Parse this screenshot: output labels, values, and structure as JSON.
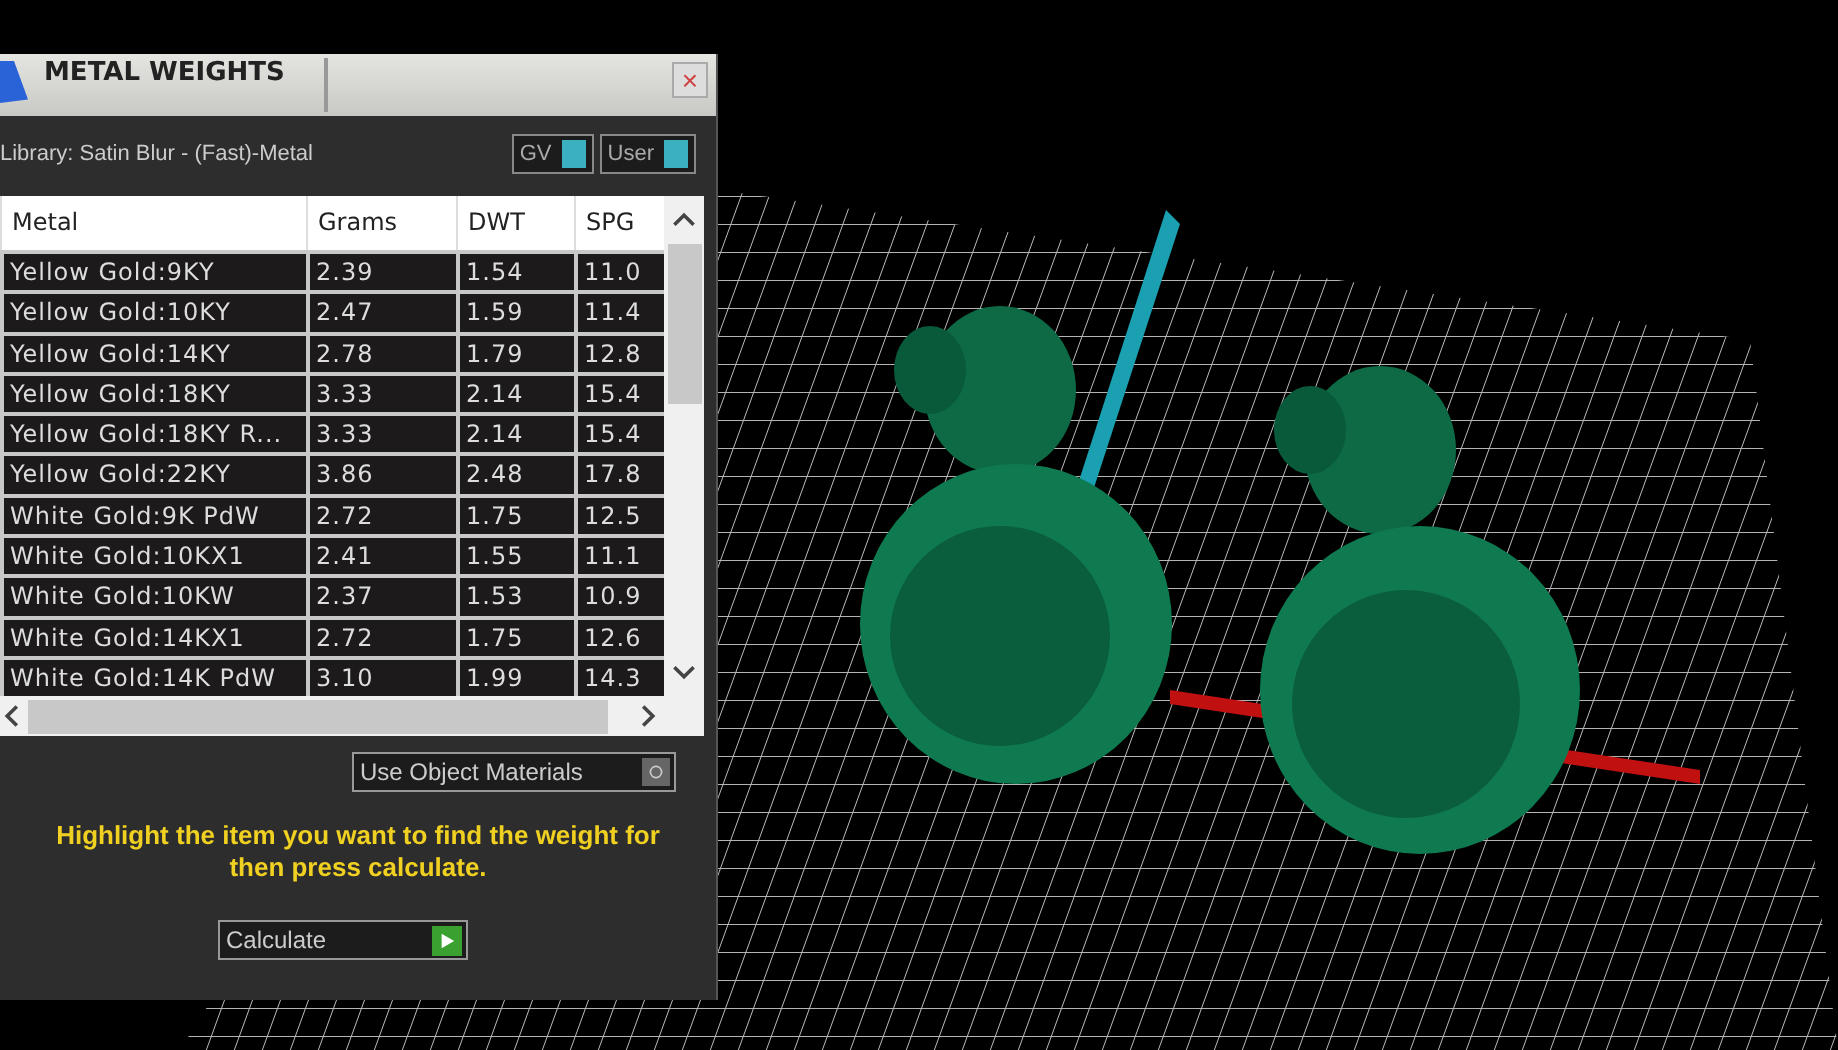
{
  "panel": {
    "title": "METAL WEIGHTS",
    "close": "×",
    "library": "Library: Satin Blur - (Fast)-Metal",
    "toggles": [
      {
        "label": "GV",
        "on": true
      },
      {
        "label": "User",
        "on": true
      }
    ],
    "table": {
      "columns": [
        "Metal",
        "Grams",
        "DWT",
        "SPG"
      ],
      "rows": [
        [
          "Yellow Gold:9KY",
          "2.39",
          "1.54",
          "11.0"
        ],
        [
          "Yellow Gold:10KY",
          "2.47",
          "1.59",
          "11.4"
        ],
        [
          "Yellow Gold:14KY",
          "2.78",
          "1.79",
          "12.8"
        ],
        [
          "Yellow Gold:18KY",
          "3.33",
          "2.14",
          "15.4"
        ],
        [
          "Yellow Gold:18KY R...",
          "3.33",
          "2.14",
          "15.4"
        ],
        [
          "Yellow Gold:22KY",
          "3.86",
          "2.48",
          "17.8"
        ],
        [
          "White Gold:9K PdW",
          "2.72",
          "1.75",
          "12.5"
        ],
        [
          "White Gold:10KX1",
          "2.41",
          "1.55",
          "11.1"
        ],
        [
          "White Gold:10KW",
          "2.37",
          "1.53",
          "10.9"
        ],
        [
          "White Gold:14KX1",
          "2.72",
          "1.75",
          "12.6"
        ],
        [
          "White Gold:14K PdW",
          "3.10",
          "1.99",
          "14.3"
        ]
      ]
    },
    "use_object_materials": {
      "label": "Use Object Materials",
      "on": false
    },
    "hint": "Highlight the item you want to find the weight for then press calculate.",
    "calculate": "Calculate"
  }
}
